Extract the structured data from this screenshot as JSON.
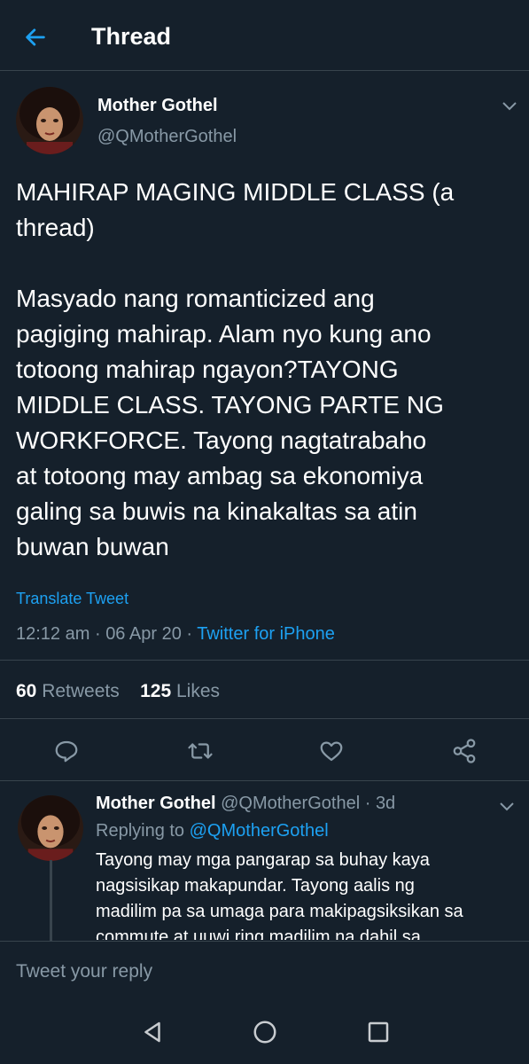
{
  "header": {
    "title": "Thread"
  },
  "tweet": {
    "name": "Mother Gothel",
    "handle": "@QMotherGothel",
    "text": "MAHIRAP MAGING MIDDLE CLASS (a\nthread)\n\nMasyado nang romanticized ang\npagiging mahirap. Alam nyo kung ano\ntotoong mahirap ngayon?TAYONG\nMIDDLE CLASS. TAYONG PARTE NG\nWORKFORCE. Tayong nagtatrabaho\nat totoong may ambag sa ekonomiya\ngaling sa buwis na kinakaltas sa atin\nbuwan buwan",
    "translate": "Translate Tweet",
    "time": "12:12 am",
    "date": "06 Apr 20",
    "source": "Twitter for iPhone",
    "retweets": "60",
    "retweets_label": "Retweets",
    "likes": "125",
    "likes_label": "Likes"
  },
  "reply": {
    "name": "Mother Gothel",
    "handle": "@QMotherGothel",
    "age": "3d",
    "replying_to_label": "Replying to",
    "replying_to_handle": "@QMotherGothel",
    "text": "Tayong may mga pangarap sa buhay kaya\nnagsisikap makapundar. Tayong aalis ng\nmadilim pa sa umaga para makipagsiksikan sa\ncommute at uuwi ring madilim na dahil sa"
  },
  "composer": {
    "placeholder": "Tweet your reply"
  },
  "icons": {
    "back": "arrow-left-icon",
    "chevron": "chevron-down-icon",
    "reply": "comment-icon",
    "retweet": "retweet-icon",
    "like": "heart-icon",
    "share": "share-icon",
    "nav_back": "triangle-back-icon",
    "nav_home": "circle-home-icon",
    "nav_recents": "square-recents-icon"
  },
  "colors": {
    "background": "#15202b",
    "accent": "#1da1f2",
    "muted": "#8899a6",
    "border": "#38444d"
  }
}
